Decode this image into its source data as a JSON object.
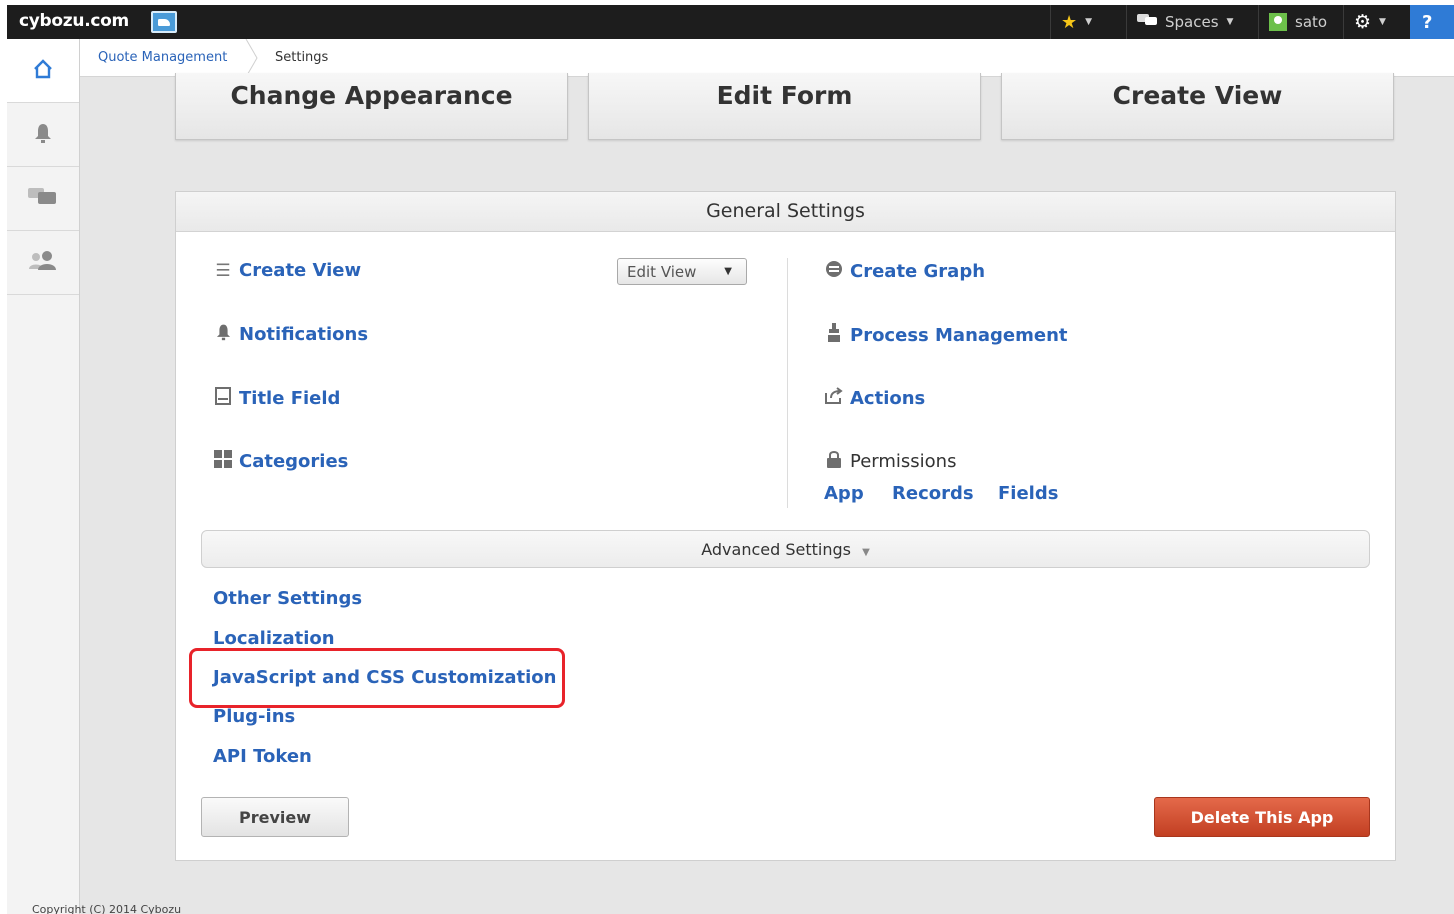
{
  "topbar": {
    "logo": "cybozu.com",
    "spaces_label": "Spaces",
    "user_label": "sato",
    "help_label": "?"
  },
  "breadcrumb": {
    "app": "Quote Management",
    "current": "Settings"
  },
  "top_buttons": {
    "change_appearance": "Change Appearance",
    "edit_form": "Edit Form",
    "create_view": "Create View"
  },
  "general": {
    "title": "General Settings",
    "create_view": "Create View",
    "edit_view_select": "Edit View",
    "notifications": "Notifications",
    "title_field": "Title Field",
    "categories": "Categories",
    "create_graph": "Create Graph",
    "process_management": "Process Management",
    "actions": "Actions",
    "permissions": "Permissions",
    "perm_app": "App",
    "perm_records": "Records",
    "perm_fields": "Fields"
  },
  "advanced": {
    "title": "Advanced Settings",
    "links": [
      "Other Settings",
      "Localization",
      "JavaScript and CSS Customization",
      "Plug-ins",
      "API Token"
    ]
  },
  "buttons": {
    "preview": "Preview",
    "delete": "Delete This App"
  },
  "footer": "Copyright (C) 2014 Cybozu",
  "colors": {
    "link": "#2a63b8",
    "delete": "#c94a2b",
    "highlight": "#e8232a",
    "topbar": "#1d1d1d"
  }
}
